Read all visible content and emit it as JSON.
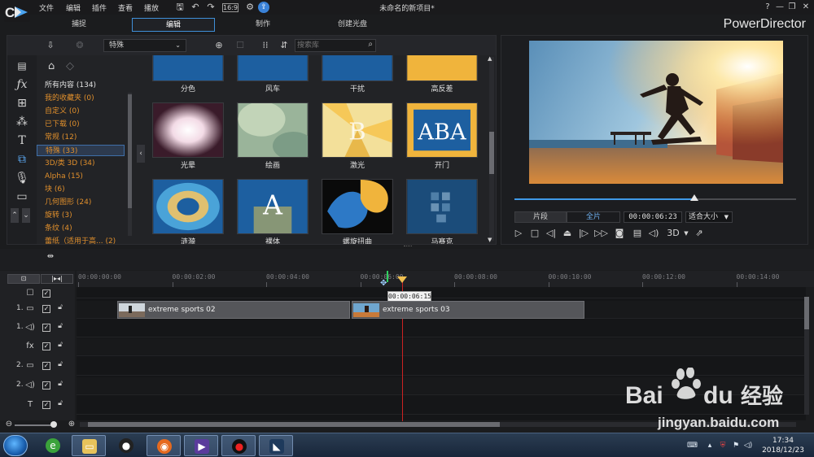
{
  "menubar": {
    "items": [
      "文件",
      "编辑",
      "插件",
      "查看",
      "播放"
    ],
    "window_title": "未命名的新项目*"
  },
  "tabs": [
    {
      "label": "捕捉",
      "active": false
    },
    {
      "label": "编辑",
      "active": true
    },
    {
      "label": "制作",
      "active": false
    },
    {
      "label": "创建光盘",
      "active": false
    }
  ],
  "brand": "PowerDirector",
  "window_controls": [
    "?",
    "—",
    "❐",
    "□",
    "✕"
  ],
  "library": {
    "category_selected": "特殊",
    "search_placeholder": "搜索库",
    "categories": [
      {
        "label": "所有内容 (134)",
        "white": true,
        "active": false
      },
      {
        "label": "我的收藏夹  (0)",
        "white": false,
        "active": false
      },
      {
        "label": "自定义  (0)",
        "white": false,
        "active": false
      },
      {
        "label": "已下载  (0)",
        "white": false,
        "active": false
      },
      {
        "label": "常规  (12)",
        "white": false,
        "active": false
      },
      {
        "label": "特殊  (33)",
        "white": false,
        "active": true
      },
      {
        "label": "3D/类 3D  (34)",
        "white": false,
        "active": false
      },
      {
        "label": "Alpha  (15)",
        "white": false,
        "active": false
      },
      {
        "label": "块  (6)",
        "white": false,
        "active": false
      },
      {
        "label": "几何图形  (24)",
        "white": false,
        "active": false
      },
      {
        "label": "旋转  (3)",
        "white": false,
        "active": false
      },
      {
        "label": "条纹  (4)",
        "white": false,
        "active": false
      },
      {
        "label": "蕾纸（适用于高...  (2)",
        "white": false,
        "active": false
      }
    ],
    "transitions": [
      {
        "label": "分色"
      },
      {
        "label": "风车"
      },
      {
        "label": "干扰"
      },
      {
        "label": "高反差"
      },
      {
        "label": "光晕"
      },
      {
        "label": "绘画"
      },
      {
        "label": "激光"
      },
      {
        "label": "开门"
      },
      {
        "label": "涟漪"
      },
      {
        "label": "裸体"
      },
      {
        "label": "螺旋扭曲"
      },
      {
        "label": "马赛克"
      }
    ]
  },
  "preview": {
    "mode_clip": "片段",
    "mode_movie": "全片",
    "timecode": "00:00:06:23",
    "fit": "适合大小",
    "scrub_fraction": 0.64,
    "mode_3d": "3D"
  },
  "timeline": {
    "mode_btn1": "⊡",
    "mode_btn2": "|▸◂|",
    "ticks": [
      "00:00:00:00",
      "00:00:02:00",
      "00:00:04:00",
      "00:00:06:00",
      "00:00:08:00",
      "00:00:10:00",
      "00:00:12:00",
      "00:00:14:00"
    ],
    "tracks": [
      {
        "num": "",
        "icon": "☐",
        "checked": true,
        "locked": false
      },
      {
        "num": "1.",
        "icon": "▭",
        "checked": true,
        "locked": true
      },
      {
        "num": "1.",
        "icon": "◁)",
        "checked": true,
        "locked": true
      },
      {
        "num": "",
        "icon": "fx",
        "checked": true,
        "locked": true
      },
      {
        "num": "2.",
        "icon": "▭",
        "checked": true,
        "locked": true
      },
      {
        "num": "2.",
        "icon": "◁)",
        "checked": true,
        "locked": true
      },
      {
        "num": "",
        "icon": "T",
        "checked": true,
        "locked": true
      }
    ],
    "clips": [
      {
        "label": "extreme sports 02"
      },
      {
        "label": "extreme sports 03"
      }
    ],
    "playhead_time": "00:00:06:15"
  },
  "taskbar": {
    "time": "17:34",
    "date": "2018/12/23"
  },
  "watermark": {
    "text": "jingyan.baidu.com"
  },
  "colors": {
    "accent_blue": "#3f9ae8",
    "category_orange": "#e08f2c",
    "playhead_red": "#cc2222"
  }
}
